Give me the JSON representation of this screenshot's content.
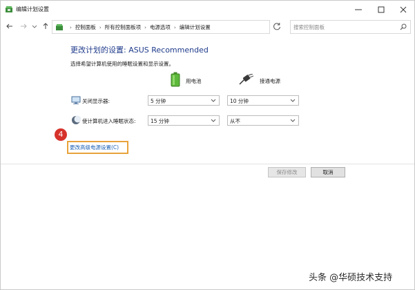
{
  "window": {
    "title": "编辑计划设置",
    "icons": {
      "app": "control-panel-icon",
      "minimize": "minimize-icon",
      "maximize": "maximize-icon",
      "close": "close-icon"
    }
  },
  "address_bar": {
    "breadcrumbs": [
      "控制面板",
      "所有控制面板项",
      "电源选项",
      "编辑计划设置"
    ],
    "search_placeholder": "搜索控制面板"
  },
  "content": {
    "heading": "更改计划的设置: ASUS Recommended",
    "subtitle": "选择希望计算机使用的睡眠设置和显示设置。",
    "columns": {
      "battery": "用电池",
      "plugged": "接通电源"
    },
    "rows": [
      {
        "label": "关闭显示器:",
        "battery_value": "5 分钟",
        "plugged_value": "10 分钟",
        "icon": "monitor-icon"
      },
      {
        "label": "使计算机进入睡眠状态:",
        "battery_value": "15 分钟",
        "plugged_value": "从不",
        "icon": "moon-icon"
      }
    ],
    "step_badge": "4",
    "advanced_link": "更改高级电源设置(C)"
  },
  "buttons": {
    "save": "保存修改",
    "cancel": "取消"
  },
  "watermark": "头条 @华硕技术支持",
  "colors": {
    "heading": "#1e3a8a",
    "link": "#1a5fb4",
    "highlight": "#e8a23a",
    "badge": "#d6322b"
  }
}
